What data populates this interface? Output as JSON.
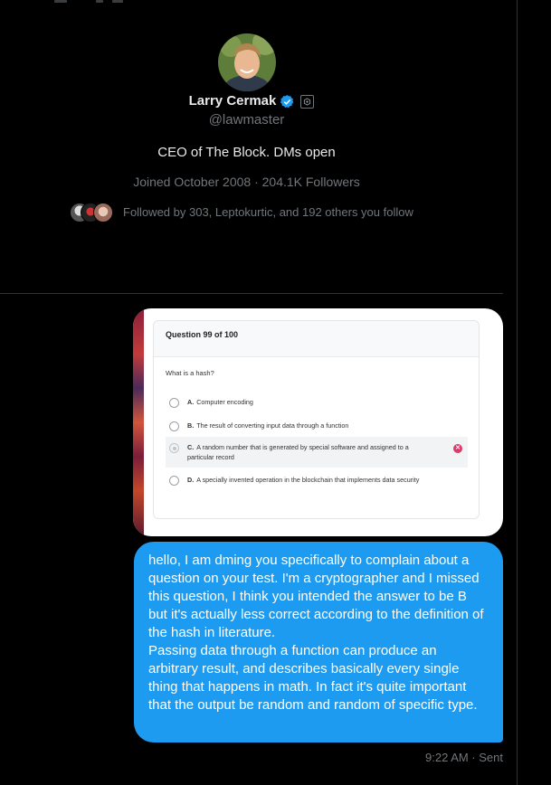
{
  "profile": {
    "name": "Larry Cermak",
    "handle": "@lawmaster",
    "bio": "CEO of The Block. DMs open",
    "meta": "Joined October 2008 · 204.1K Followers",
    "followed_by": "Followed by 303, Leptokurtic, and 192 others you follow"
  },
  "quiz": {
    "header": "Question 99 of 100",
    "question": "What is a hash?",
    "options": [
      {
        "letter": "A.",
        "text": "Computer encoding"
      },
      {
        "letter": "B.",
        "text": "The result of converting input data through a function"
      },
      {
        "letter": "C.",
        "text": "A random number that is generated by special software and assigned to a particular record"
      },
      {
        "letter": "D.",
        "text": "A specially invented operation in the blockchain that implements data security"
      }
    ]
  },
  "message": {
    "text": "hello, I am dming you specifically to complain about a question on your test. I'm a cryptographer and I missed this question, I think you intended the answer to be B but it's actually less correct according to the definition of the hash in literature.\nPassing data through a function can produce an arbitrary result, and describes basically every single thing that happens in math. In fact it's quite important that the output be random and random of specific type.",
    "timestamp": "9:22 AM · Sent"
  },
  "colors": {
    "background": "#000000",
    "bubble": "#1d9bf0",
    "verified": "#1d9bf0",
    "muted": "#71767b",
    "wrong_answer": "#d93b6a"
  },
  "icons": {
    "verified": "verified-badge-icon",
    "affiliate": "affiliate-icon",
    "wrong": "close-icon"
  }
}
